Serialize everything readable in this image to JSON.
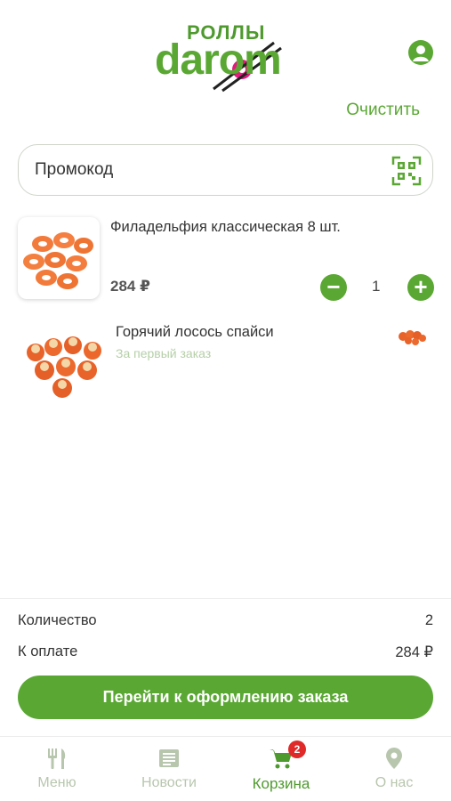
{
  "header": {
    "logo_top": "РОЛЛЫ",
    "logo_main": "darom",
    "profile_icon": "user-circle-icon"
  },
  "actions": {
    "clear_label": "Очистить"
  },
  "promo": {
    "placeholder": "Промокод",
    "value": "",
    "scan_icon": "qr-code-icon"
  },
  "cart": {
    "items": [
      {
        "name": "Филадельфия классическая 8 шт.",
        "price": "284 ₽",
        "quantity": "1",
        "image": "roll-set-image"
      }
    ],
    "gift": {
      "name": "Горячий лосось спайси",
      "subtitle": "За первый заказ",
      "image": "hot-roll-image"
    }
  },
  "summary": {
    "quantity_label": "Количество",
    "quantity_value": "2",
    "total_label": "К оплате",
    "total_value": "284 ₽"
  },
  "checkout": {
    "label": "Перейти к оформлению заказа"
  },
  "tabs": [
    {
      "label": "Меню",
      "icon": "fork-knife-icon",
      "active": false
    },
    {
      "label": "Новости",
      "icon": "newspaper-icon",
      "active": false
    },
    {
      "label": "Корзина",
      "icon": "cart-icon",
      "active": true,
      "badge": "2"
    },
    {
      "label": "О нас",
      "icon": "map-pin-icon",
      "active": false
    }
  ],
  "colors": {
    "accent": "#5aa833",
    "inactive": "#b8c6ae",
    "badge": "#e02a2a"
  }
}
